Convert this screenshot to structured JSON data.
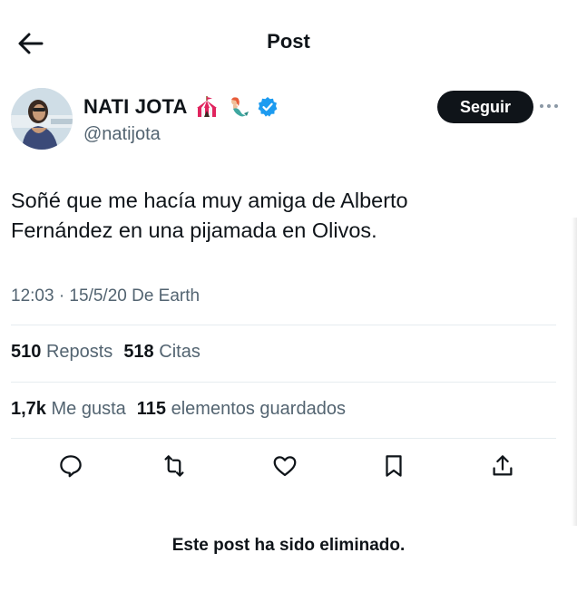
{
  "header": {
    "title": "Post",
    "back_icon": "arrow-left-icon"
  },
  "author": {
    "name": "NATI JOTA",
    "handle": "@natijota",
    "emojis": [
      "circus-tent-icon",
      "mermaid-icon"
    ],
    "verified": true,
    "verified_color": "#1d9bf0",
    "follow_label": "Seguir",
    "more_icon": "more-horizontal-icon"
  },
  "tweet": {
    "text_line1": "Soñé que me hacía muy amiga de Alberto",
    "text_line2": "Fernández en una pijamada en Olivos.",
    "meta": "12:03 · 15/5/20 De Earth"
  },
  "stats": {
    "reposts_count": "510",
    "reposts_label": "Reposts",
    "quotes_count": "518",
    "quotes_label": "Citas",
    "likes_count": "1,7k",
    "likes_label": "Me gusta",
    "bookmarks_count": "115",
    "bookmarks_label": "elementos guardados"
  },
  "actions": [
    "reply-icon",
    "repost-icon",
    "like-icon",
    "bookmark-icon",
    "share-icon"
  ],
  "footer": {
    "deleted_notice": "Este post ha sido eliminado."
  }
}
